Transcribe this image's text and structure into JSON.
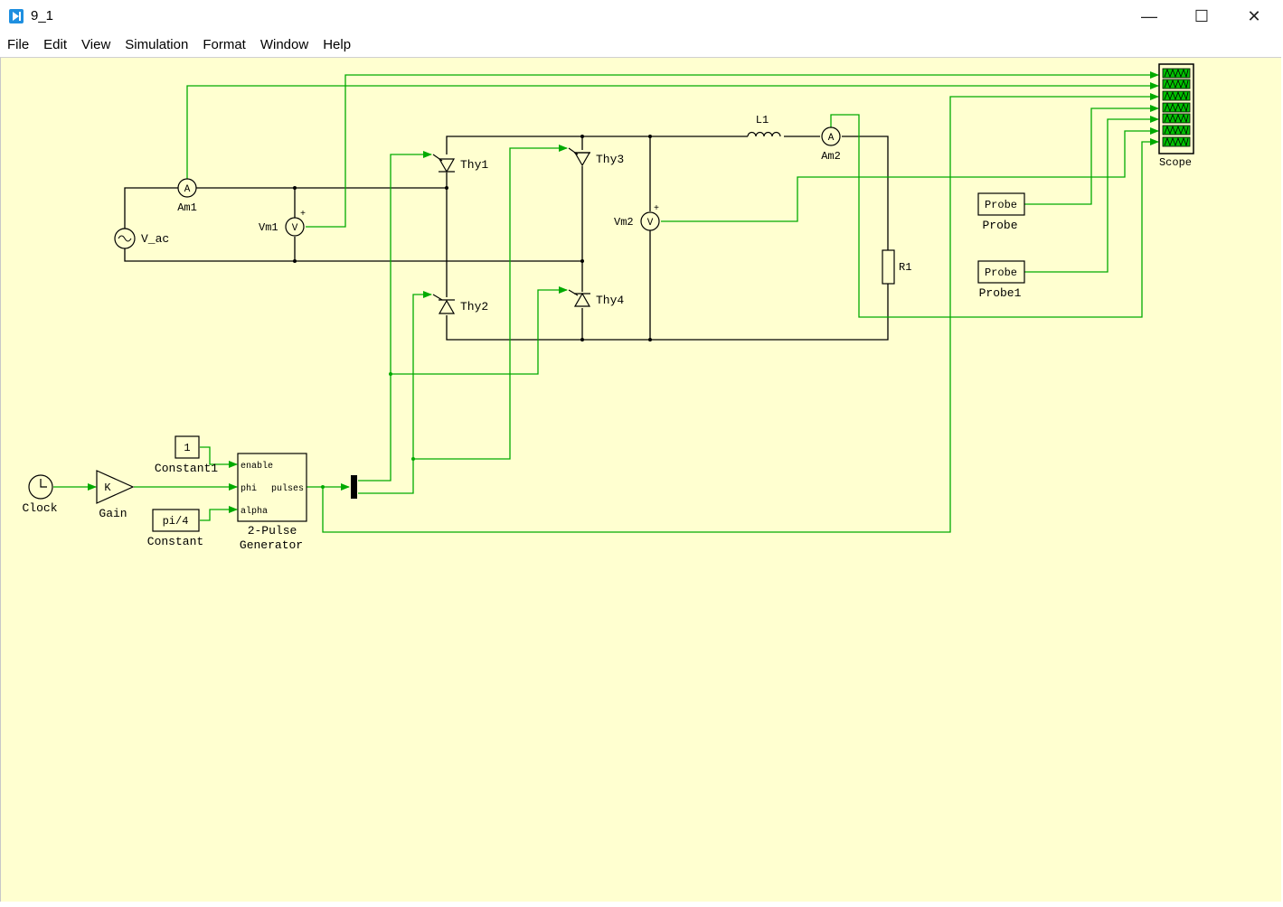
{
  "window": {
    "title": "9_1",
    "minimize_glyph": "—",
    "maximize_glyph": "☐",
    "close_glyph": "✕"
  },
  "menu": [
    "File",
    "Edit",
    "View",
    "Simulation",
    "Format",
    "Window",
    "Help"
  ],
  "blocks": {
    "clock": "Clock",
    "gain": "Gain",
    "gain_symbol": "K",
    "constant1_value": "1",
    "constant1": "Constant1",
    "constant_value": "pi/4",
    "constant": "Constant",
    "pulse_gen_line1": "2-Pulse",
    "pulse_gen_line2": "Generator",
    "port_enable": "enable",
    "port_phi": "phi",
    "port_pulses": "pulses",
    "port_alpha": "alpha",
    "vac": "V_ac",
    "am1": "Am1",
    "am2": "Am2",
    "ammeter_symbol": "A",
    "voltmeter_symbol": "V",
    "vm1": "Vm1",
    "vm2": "Vm2",
    "thy1": "Thy1",
    "thy2": "Thy2",
    "thy3": "Thy3",
    "thy4": "Thy4",
    "l1": "L1",
    "r1": "R1",
    "probe_block": "Probe",
    "probe_label": "Probe",
    "probe1_block": "Probe",
    "probe1_label": "Probe1",
    "scope": "Scope",
    "plus": "+"
  },
  "colors": {
    "canvas_bg": "#ffffd0",
    "signal_wire": "#00aa00",
    "power_wire": "#000000",
    "scope_screen": "#00c000"
  }
}
